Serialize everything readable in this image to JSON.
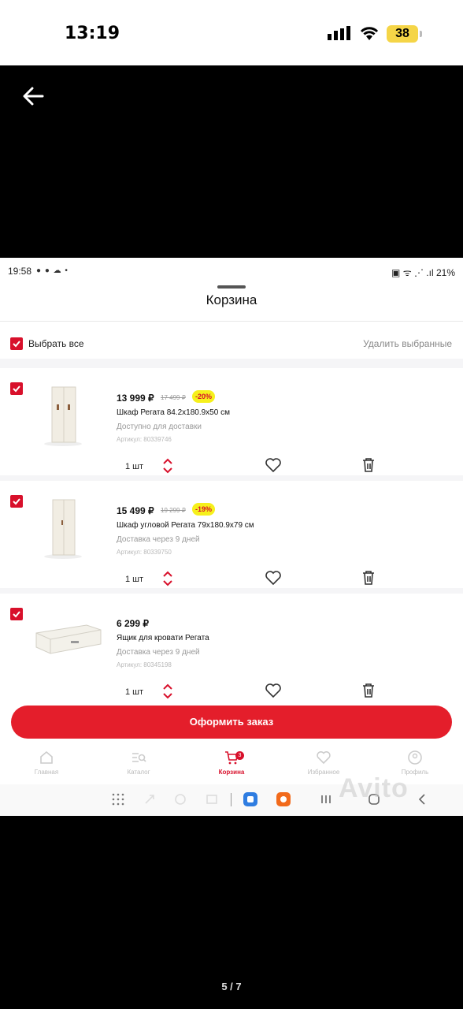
{
  "ios_status": {
    "time": "13:19",
    "battery": "38"
  },
  "android_status": {
    "time": "19:58",
    "icons": "● ● ☁ •",
    "right": "▣ ᯤ ⋰ .ıl 21%"
  },
  "cart": {
    "title": "Корзина",
    "select_all": "Выбрать все",
    "delete_selected": "Удалить выбранные",
    "items": [
      {
        "price": "13 999 ₽",
        "old_price": "17 499 ₽",
        "discount": "-20%",
        "name": "Шкаф Регата 84.2x180.9x50 см",
        "availability": "Доступно для доставки",
        "sku": "Артикул: 80339746",
        "qty": "1 шт"
      },
      {
        "price": "15 499 ₽",
        "old_price": "19 299 ₽",
        "discount": "-19%",
        "name": "Шкаф угловой Регата 79x180.9x79 см",
        "availability": "Доставка через  9 дней",
        "sku": "Артикул: 80339750",
        "qty": "1 шт"
      },
      {
        "price": "6 299 ₽",
        "old_price": "",
        "discount": "",
        "name": "Ящик для кровати Регата",
        "availability": "Доставка через  9 дней",
        "sku": "Артикул: 80345198",
        "qty": "1 шт"
      }
    ],
    "order_button": "Оформить заказ"
  },
  "bottom_nav": [
    {
      "label": "Главная",
      "icon": "home-icon"
    },
    {
      "label": "Каталог",
      "icon": "catalog-icon"
    },
    {
      "label": "Корзина",
      "icon": "cart-icon",
      "badge": "3"
    },
    {
      "label": "Избранное",
      "icon": "heart-icon"
    },
    {
      "label": "Профиль",
      "icon": "profile-icon"
    }
  ],
  "watermark": "Avito",
  "pager": "5 / 7",
  "colors": {
    "accent": "#e41e2b",
    "discount_badge": "#f6f01c",
    "ios_battery": "#f5d547"
  }
}
